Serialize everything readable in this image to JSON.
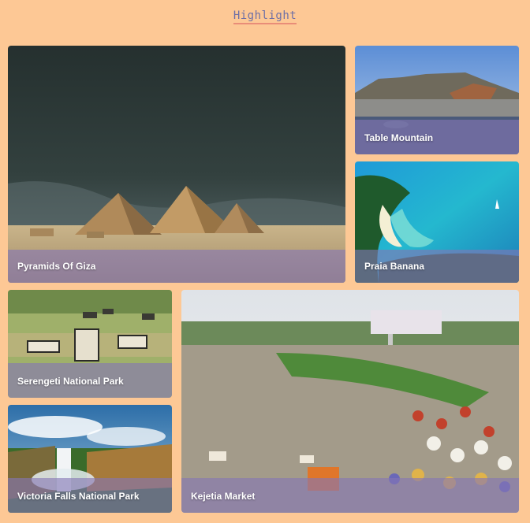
{
  "page": {
    "title": "Highlight"
  },
  "cards": [
    {
      "id": "giza",
      "label": "Pyramids Of Giza"
    },
    {
      "id": "table",
      "label": "Table Mountain"
    },
    {
      "id": "praia",
      "label": "Praia Banana"
    },
    {
      "id": "serengeti",
      "label": "Serengeti National Park"
    },
    {
      "id": "victoria",
      "label": "Victoria Falls National Park"
    },
    {
      "id": "kejetia",
      "label": "Kejetia Market"
    }
  ],
  "colors": {
    "background": "#fdc895",
    "title": "#6d6fa6",
    "title_underline": "#e98d78",
    "label_band": "#8476b4"
  }
}
